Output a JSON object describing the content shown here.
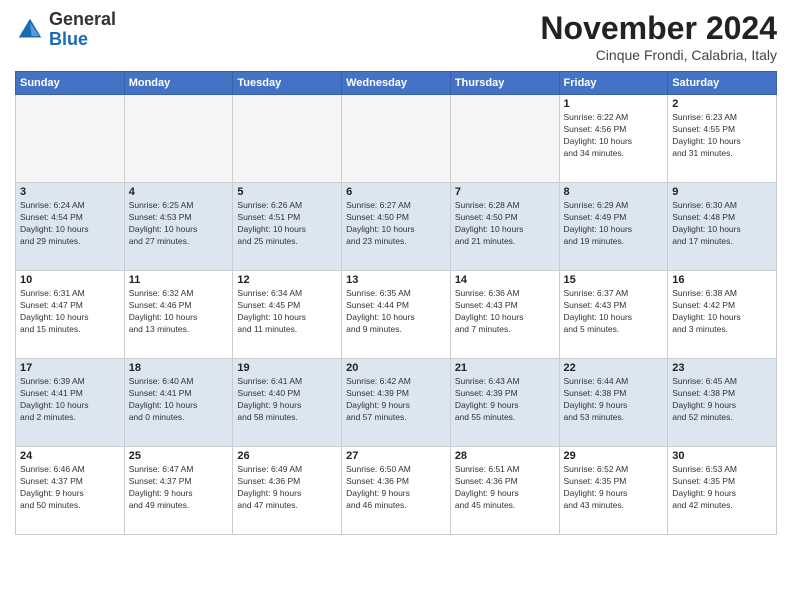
{
  "header": {
    "logo_general": "General",
    "logo_blue": "Blue",
    "month_title": "November 2024",
    "subtitle": "Cinque Frondi, Calabria, Italy"
  },
  "days_of_week": [
    "Sunday",
    "Monday",
    "Tuesday",
    "Wednesday",
    "Thursday",
    "Friday",
    "Saturday"
  ],
  "weeks": [
    [
      {
        "day": "",
        "info": ""
      },
      {
        "day": "",
        "info": ""
      },
      {
        "day": "",
        "info": ""
      },
      {
        "day": "",
        "info": ""
      },
      {
        "day": "",
        "info": ""
      },
      {
        "day": "1",
        "info": "Sunrise: 6:22 AM\nSunset: 4:56 PM\nDaylight: 10 hours\nand 34 minutes."
      },
      {
        "day": "2",
        "info": "Sunrise: 6:23 AM\nSunset: 4:55 PM\nDaylight: 10 hours\nand 31 minutes."
      }
    ],
    [
      {
        "day": "3",
        "info": "Sunrise: 6:24 AM\nSunset: 4:54 PM\nDaylight: 10 hours\nand 29 minutes."
      },
      {
        "day": "4",
        "info": "Sunrise: 6:25 AM\nSunset: 4:53 PM\nDaylight: 10 hours\nand 27 minutes."
      },
      {
        "day": "5",
        "info": "Sunrise: 6:26 AM\nSunset: 4:51 PM\nDaylight: 10 hours\nand 25 minutes."
      },
      {
        "day": "6",
        "info": "Sunrise: 6:27 AM\nSunset: 4:50 PM\nDaylight: 10 hours\nand 23 minutes."
      },
      {
        "day": "7",
        "info": "Sunrise: 6:28 AM\nSunset: 4:50 PM\nDaylight: 10 hours\nand 21 minutes."
      },
      {
        "day": "8",
        "info": "Sunrise: 6:29 AM\nSunset: 4:49 PM\nDaylight: 10 hours\nand 19 minutes."
      },
      {
        "day": "9",
        "info": "Sunrise: 6:30 AM\nSunset: 4:48 PM\nDaylight: 10 hours\nand 17 minutes."
      }
    ],
    [
      {
        "day": "10",
        "info": "Sunrise: 6:31 AM\nSunset: 4:47 PM\nDaylight: 10 hours\nand 15 minutes."
      },
      {
        "day": "11",
        "info": "Sunrise: 6:32 AM\nSunset: 4:46 PM\nDaylight: 10 hours\nand 13 minutes."
      },
      {
        "day": "12",
        "info": "Sunrise: 6:34 AM\nSunset: 4:45 PM\nDaylight: 10 hours\nand 11 minutes."
      },
      {
        "day": "13",
        "info": "Sunrise: 6:35 AM\nSunset: 4:44 PM\nDaylight: 10 hours\nand 9 minutes."
      },
      {
        "day": "14",
        "info": "Sunrise: 6:36 AM\nSunset: 4:43 PM\nDaylight: 10 hours\nand 7 minutes."
      },
      {
        "day": "15",
        "info": "Sunrise: 6:37 AM\nSunset: 4:43 PM\nDaylight: 10 hours\nand 5 minutes."
      },
      {
        "day": "16",
        "info": "Sunrise: 6:38 AM\nSunset: 4:42 PM\nDaylight: 10 hours\nand 3 minutes."
      }
    ],
    [
      {
        "day": "17",
        "info": "Sunrise: 6:39 AM\nSunset: 4:41 PM\nDaylight: 10 hours\nand 2 minutes."
      },
      {
        "day": "18",
        "info": "Sunrise: 6:40 AM\nSunset: 4:41 PM\nDaylight: 10 hours\nand 0 minutes."
      },
      {
        "day": "19",
        "info": "Sunrise: 6:41 AM\nSunset: 4:40 PM\nDaylight: 9 hours\nand 58 minutes."
      },
      {
        "day": "20",
        "info": "Sunrise: 6:42 AM\nSunset: 4:39 PM\nDaylight: 9 hours\nand 57 minutes."
      },
      {
        "day": "21",
        "info": "Sunrise: 6:43 AM\nSunset: 4:39 PM\nDaylight: 9 hours\nand 55 minutes."
      },
      {
        "day": "22",
        "info": "Sunrise: 6:44 AM\nSunset: 4:38 PM\nDaylight: 9 hours\nand 53 minutes."
      },
      {
        "day": "23",
        "info": "Sunrise: 6:45 AM\nSunset: 4:38 PM\nDaylight: 9 hours\nand 52 minutes."
      }
    ],
    [
      {
        "day": "24",
        "info": "Sunrise: 6:46 AM\nSunset: 4:37 PM\nDaylight: 9 hours\nand 50 minutes."
      },
      {
        "day": "25",
        "info": "Sunrise: 6:47 AM\nSunset: 4:37 PM\nDaylight: 9 hours\nand 49 minutes."
      },
      {
        "day": "26",
        "info": "Sunrise: 6:49 AM\nSunset: 4:36 PM\nDaylight: 9 hours\nand 47 minutes."
      },
      {
        "day": "27",
        "info": "Sunrise: 6:50 AM\nSunset: 4:36 PM\nDaylight: 9 hours\nand 46 minutes."
      },
      {
        "day": "28",
        "info": "Sunrise: 6:51 AM\nSunset: 4:36 PM\nDaylight: 9 hours\nand 45 minutes."
      },
      {
        "day": "29",
        "info": "Sunrise: 6:52 AM\nSunset: 4:35 PM\nDaylight: 9 hours\nand 43 minutes."
      },
      {
        "day": "30",
        "info": "Sunrise: 6:53 AM\nSunset: 4:35 PM\nDaylight: 9 hours\nand 42 minutes."
      }
    ]
  ]
}
